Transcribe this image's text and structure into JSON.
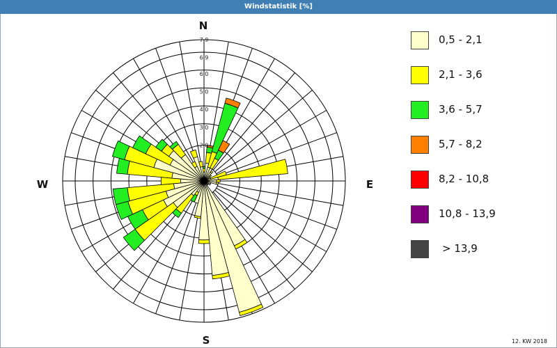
{
  "window": {
    "title": "Windstatistik [%]"
  },
  "footer": {
    "label": "12. KW 2018"
  },
  "colors": {
    "bins": [
      "#ffffcc",
      "#ffff00",
      "#22ee22",
      "#ff8000",
      "#ff0000",
      "#800080",
      "#444444"
    ],
    "grid": "#000000"
  },
  "chart_data": {
    "type": "wind-rose",
    "title": "Windstatistik [%]",
    "unit": "%",
    "directions": [
      "N",
      "E",
      "S",
      "W"
    ],
    "radial_ticks": [
      "2,0",
      "3,0",
      "4,0",
      "5,0",
      "6,0",
      "6,9",
      "7,9"
    ],
    "rmax": 7.9,
    "sector_count": 36,
    "speed_bins": [
      "0,5 - 2,1",
      "2,1 - 3,6",
      "3,6 - 5,7",
      "5,7 - 8,2",
      "8,2 - 10,8",
      "10,8 - 13,9",
      "> 13,9"
    ],
    "sectors": [
      {
        "bearing": 0,
        "values": [
          0.5,
          0.2,
          0.1,
          0,
          0,
          0,
          0
        ]
      },
      {
        "bearing": 10,
        "values": [
          1.0,
          0.6,
          0.3,
          0.1,
          0,
          0,
          0
        ]
      },
      {
        "bearing": 20,
        "values": [
          0.8,
          0.9,
          2.8,
          0.3,
          0,
          0,
          0
        ]
      },
      {
        "bearing": 30,
        "values": [
          0.8,
          0.6,
          0.5,
          0.6,
          0,
          0,
          0
        ]
      },
      {
        "bearing": 40,
        "values": [
          0.6,
          0.1,
          0,
          0,
          0,
          0,
          0
        ]
      },
      {
        "bearing": 50,
        "values": [
          0.4,
          0.1,
          0,
          0,
          0,
          0,
          0
        ]
      },
      {
        "bearing": 60,
        "values": [
          0.3,
          0.1,
          0,
          0,
          0,
          0,
          0
        ]
      },
      {
        "bearing": 70,
        "values": [
          0.4,
          0.9,
          0,
          0,
          0,
          0,
          0
        ]
      },
      {
        "bearing": 80,
        "values": [
          0.8,
          3.9,
          0,
          0,
          0,
          0,
          0
        ]
      },
      {
        "bearing": 90,
        "values": [
          0.7,
          0.2,
          0,
          0,
          0,
          0,
          0
        ]
      },
      {
        "bearing": 100,
        "values": [
          0.7,
          0.1,
          0,
          0,
          0,
          0,
          0
        ]
      },
      {
        "bearing": 110,
        "values": [
          0.4,
          0,
          0,
          0,
          0,
          0,
          0
        ]
      },
      {
        "bearing": 120,
        "values": [
          0.4,
          0,
          0,
          0,
          0,
          0,
          0
        ]
      },
      {
        "bearing": 130,
        "values": [
          0.3,
          0,
          0,
          0,
          0,
          0,
          0
        ]
      },
      {
        "bearing": 140,
        "values": [
          0.3,
          0,
          0,
          0,
          0,
          0,
          0
        ]
      },
      {
        "bearing": 150,
        "values": [
          4.0,
          0.2,
          0,
          0,
          0,
          0,
          0
        ]
      },
      {
        "bearing": 160,
        "values": [
          7.6,
          0.2,
          0,
          0,
          0,
          0,
          0
        ]
      },
      {
        "bearing": 170,
        "values": [
          5.3,
          0.2,
          0,
          0,
          0,
          0,
          0
        ]
      },
      {
        "bearing": 180,
        "values": [
          3.3,
          0.2,
          0,
          0,
          0,
          0,
          0
        ]
      },
      {
        "bearing": 190,
        "values": [
          2.0,
          0.1,
          0,
          0,
          0,
          0,
          0
        ]
      },
      {
        "bearing": 200,
        "values": [
          1.3,
          0,
          0,
          0,
          0,
          0,
          0
        ]
      },
      {
        "bearing": 210,
        "values": [
          0.7,
          0.2,
          0.4,
          0,
          0,
          0,
          0
        ]
      },
      {
        "bearing": 220,
        "values": [
          1.0,
          1.2,
          0.3,
          0,
          0,
          0,
          0
        ]
      },
      {
        "bearing": 230,
        "values": [
          2.1,
          2.6,
          0.8,
          0,
          0,
          0,
          0
        ]
      },
      {
        "bearing": 240,
        "values": [
          2.5,
          1.3,
          0.9,
          0,
          0,
          0,
          0
        ]
      },
      {
        "bearing": 250,
        "values": [
          2.2,
          2.2,
          0.7,
          0,
          0,
          0,
          0
        ]
      },
      {
        "bearing": 260,
        "values": [
          1.7,
          2.6,
          0.8,
          0,
          0,
          0,
          0
        ]
      },
      {
        "bearing": 270,
        "values": [
          1.3,
          1.1,
          0,
          0,
          0,
          0,
          0
        ]
      },
      {
        "bearing": 280,
        "values": [
          1.8,
          2.5,
          0.6,
          0,
          0,
          0,
          0
        ]
      },
      {
        "bearing": 290,
        "values": [
          2.9,
          1.7,
          0.7,
          0,
          0,
          0,
          0
        ]
      },
      {
        "bearing": 300,
        "values": [
          2.1,
          1.5,
          0.8,
          0,
          0,
          0,
          0
        ]
      },
      {
        "bearing": 310,
        "values": [
          2.4,
          0.5,
          0.4,
          0,
          0,
          0,
          0
        ]
      },
      {
        "bearing": 320,
        "values": [
          1.8,
          0.7,
          0.2,
          0,
          0,
          0,
          0
        ]
      },
      {
        "bearing": 330,
        "values": [
          0.9,
          0.3,
          0,
          0,
          0,
          0,
          0
        ]
      },
      {
        "bearing": 340,
        "values": [
          1.4,
          0.4,
          0,
          0,
          0,
          0,
          0
        ]
      },
      {
        "bearing": 350,
        "values": [
          0.8,
          0.3,
          0,
          0,
          0,
          0,
          0
        ]
      }
    ]
  }
}
